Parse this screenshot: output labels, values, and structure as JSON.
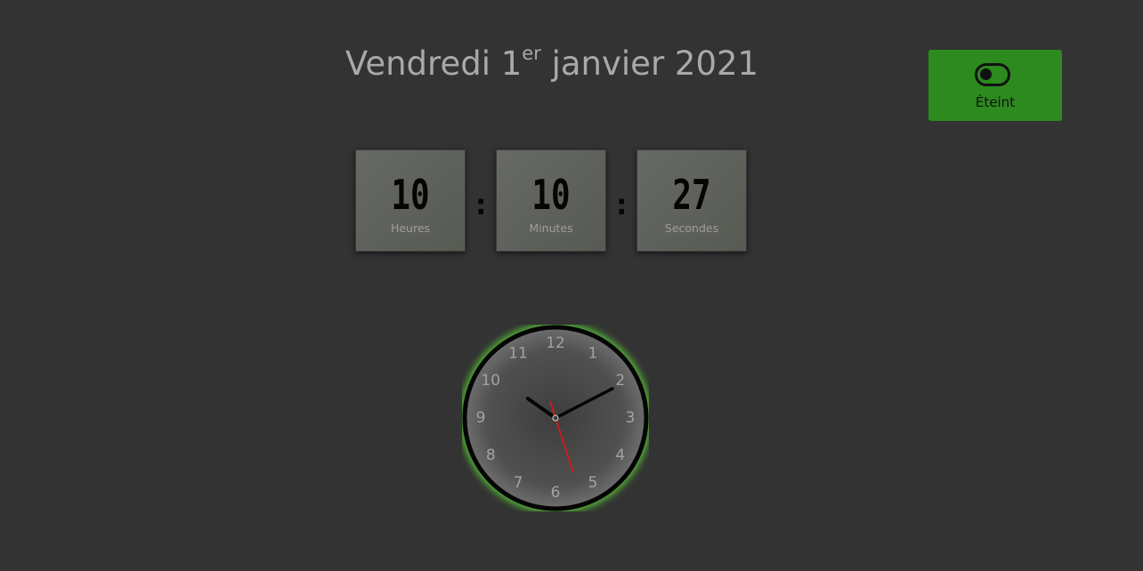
{
  "date": {
    "weekday_and_day": "Vendredi 1",
    "ordinal_suffix": "er",
    "month_and_year": " janvier 2021"
  },
  "toggle": {
    "label": "Éteint",
    "icon": "toggle-off-icon",
    "state": "off",
    "color": "#2c8a1f"
  },
  "digital_clock": {
    "hours": {
      "value": "10",
      "unit": "Heures"
    },
    "minutes": {
      "value": "10",
      "unit": "Minutes"
    },
    "seconds": {
      "value": "27",
      "unit": "Secondes"
    },
    "separator": ":"
  },
  "analog_clock": {
    "numbers": [
      "12",
      "1",
      "2",
      "3",
      "4",
      "5",
      "6",
      "7",
      "8",
      "9",
      "10",
      "11"
    ],
    "time": {
      "hours": 10,
      "minutes": 10,
      "seconds": 27
    },
    "glow_color": "#5fdc3a",
    "second_hand_color": "#c81e1e"
  }
}
